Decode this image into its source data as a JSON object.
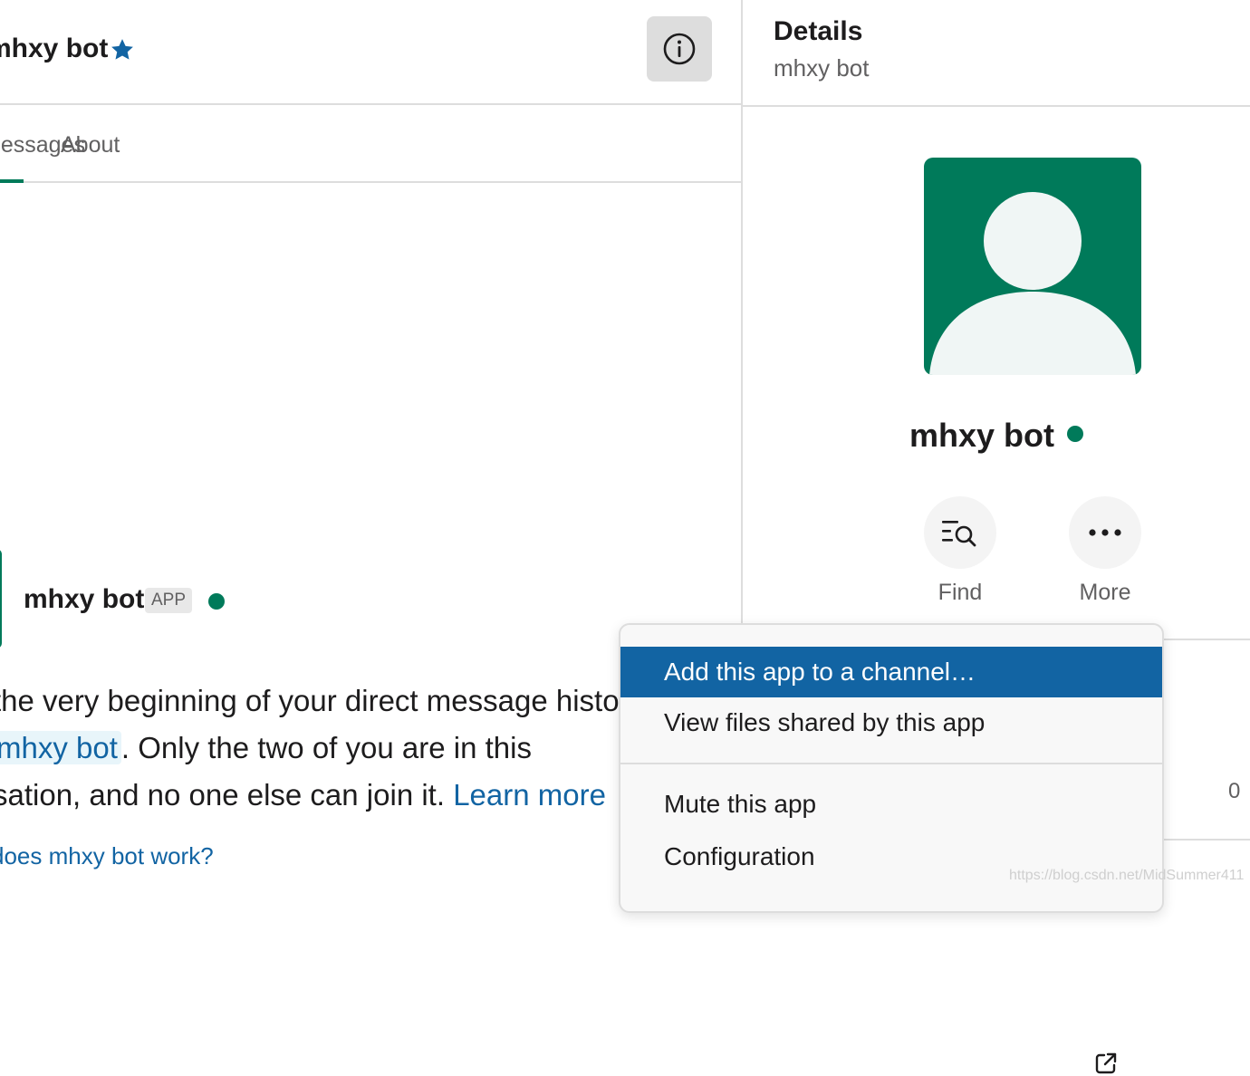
{
  "conversation": {
    "title": "mhxy bot",
    "tabs": [
      "Messages",
      "About"
    ]
  },
  "message": {
    "author": "mhxy bot",
    "badge": "APP",
    "intro_line1": "the very beginning of your direct message history",
    "intro_line2_mention": "mhxy bot",
    "intro_line2_rest": ". Only the two of you are in this",
    "intro_line3_text": "sation, and no one else can join it. ",
    "intro_line3_link": "Learn more",
    "how_link": "does mhxy bot work?"
  },
  "details": {
    "title": "Details",
    "subtitle": "mhxy bot",
    "profile_name": "mhxy bot",
    "actions": [
      {
        "label": "Find",
        "icon": "find-search-icon"
      },
      {
        "label": "More",
        "icon": "more-ellipsis-icon"
      }
    ],
    "count_value": "0"
  },
  "menu": {
    "items": [
      {
        "label": "Add this app to a channel…",
        "active": true
      },
      {
        "label": "View files shared by this app",
        "active": false
      },
      {
        "label": "Mute this app",
        "active": false
      },
      {
        "label": "Configuration",
        "active": false,
        "icon": "external-link-icon"
      }
    ]
  },
  "watermark": "https://blog.csdn.net/MidSummer411",
  "colors": {
    "accent_green": "#007a5a",
    "link_blue": "#1264a3",
    "menu_highlight": "#1264a3",
    "star_blue": "#1264a3"
  }
}
